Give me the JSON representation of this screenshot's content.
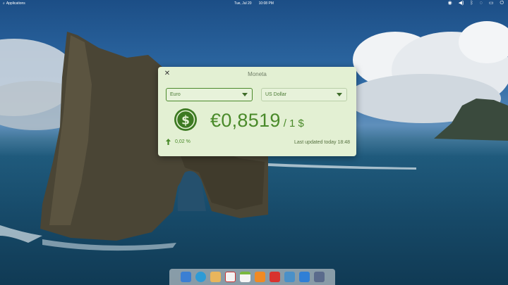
{
  "panel": {
    "applications_label": "Applications",
    "date": "Tue, Jul 20",
    "time": "10:08 PM",
    "tray_icons": [
      "network-icon",
      "volume-icon",
      "bluetooth-icon",
      "notifications-icon",
      "battery-icon",
      "power-icon"
    ]
  },
  "window": {
    "title": "Moneta",
    "from_currency": "Euro",
    "to_currency": "US Dollar",
    "rate": "€0,8519",
    "per_unit": "/ 1 $",
    "change": "0,02 %",
    "change_direction": "up",
    "last_updated": "Last updated today 18:48",
    "accent_color": "#4a8a2a",
    "background_color": "#e3f0d3"
  },
  "dock": {
    "apps": [
      "files-icon",
      "browser-icon",
      "mail-icon",
      "tasks-icon",
      "calendar-icon",
      "music-icon",
      "videos-icon",
      "photos-icon",
      "app-center-icon",
      "settings-icon"
    ]
  }
}
